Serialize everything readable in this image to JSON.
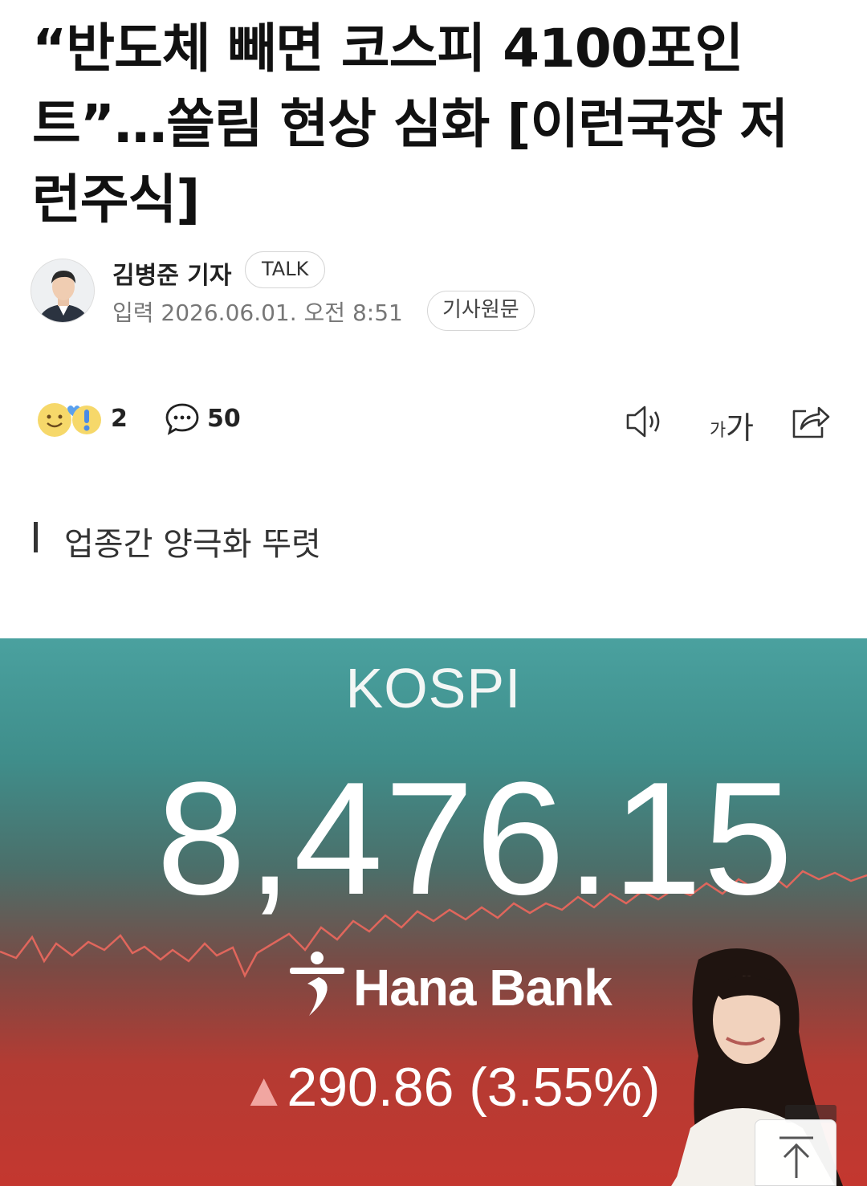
{
  "article": {
    "headline": "“반도체 빼면 코스피 4100포인트”…쏠림 현상 심화 [이런국장 저런주식]",
    "subhead": "업종간 양극화 뚜렷"
  },
  "byline": {
    "author": "김병준 기자",
    "talk_label": "TALK",
    "date": "입력 2026.06.01. 오전 8:51",
    "source_label": "기사원문"
  },
  "toolbar": {
    "reaction_count": "2",
    "comment_count": "50",
    "icons": [
      "reaction-emoji-icon",
      "comment-icon",
      "speaker-icon",
      "font-size-icon",
      "share-icon"
    ],
    "font_small": "가",
    "font_big": "가"
  },
  "photo": {
    "board_title": "KOSPI",
    "index_value": "8,476.15",
    "bank_name": "Hana Bank",
    "change_arrow": "▲",
    "change_text": "290.86 (3.55%)"
  },
  "colors": {
    "board_top": "#4aa19f",
    "board_bottom": "#c4372f",
    "change_arrow": "#f1a6a1",
    "chart_line": "#e0665c"
  }
}
